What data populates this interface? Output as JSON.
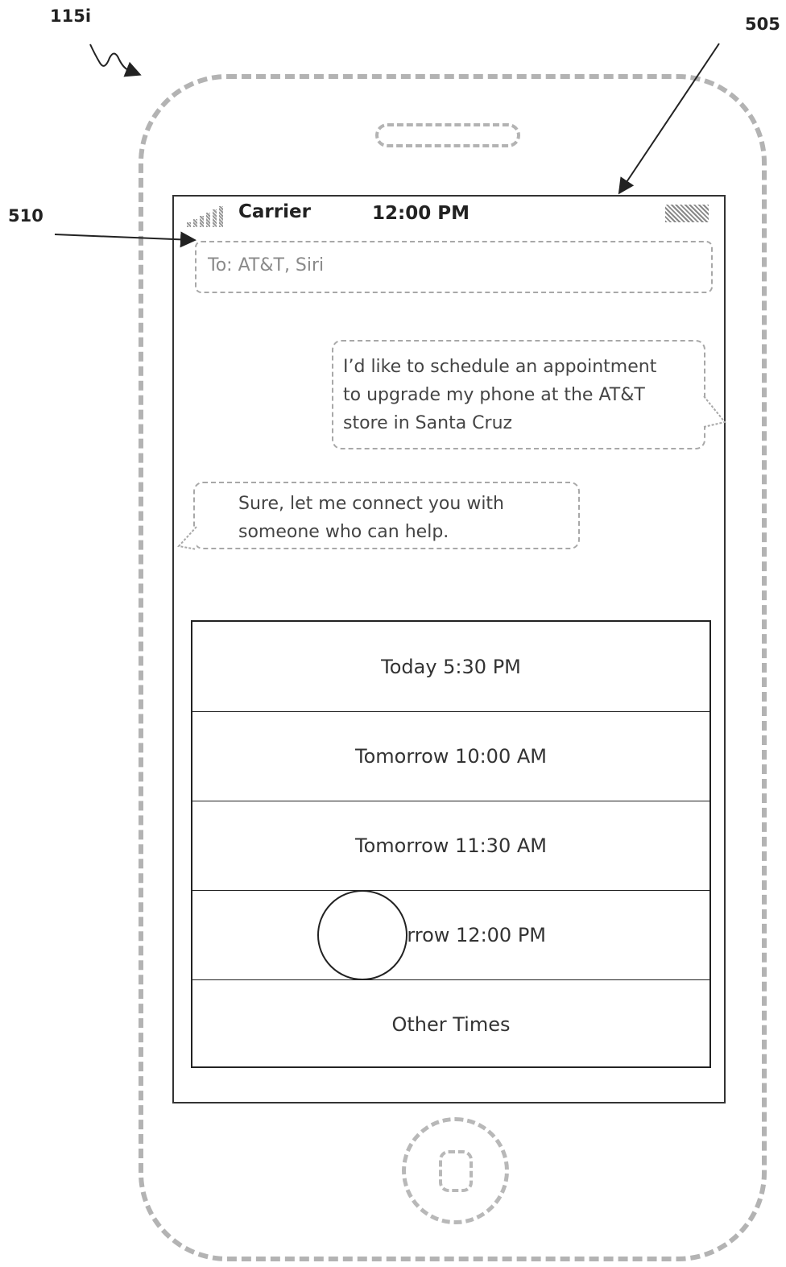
{
  "figure_refs": {
    "device": "115i",
    "screen": "505",
    "to_field": "510"
  },
  "status_bar": {
    "carrier": "Carrier",
    "time": "12:00 PM",
    "signal_icon": "signal-bars-icon",
    "battery_icon": "battery-icon"
  },
  "message": {
    "to_field": "To: AT&T, Siri",
    "outgoing_lines": [
      "I’d like to schedule an appointment",
      "to upgrade my phone at the AT&T",
      "store in Santa Cruz"
    ],
    "incoming_lines": [
      "Sure, let me connect you with",
      "someone who can help."
    ]
  },
  "time_options": [
    "Today 5:30 PM",
    "Tomorrow 10:00 AM",
    "Tomorrow 11:30 AM",
    "Tomorrow 12:00 PM",
    "Other Times"
  ]
}
